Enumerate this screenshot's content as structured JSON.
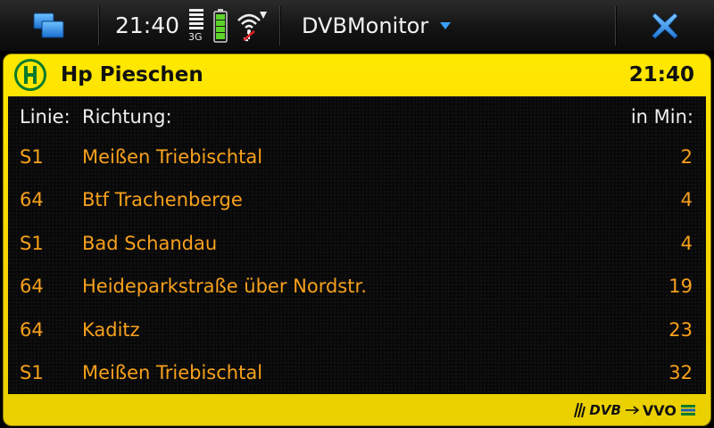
{
  "statusbar": {
    "clock": "21:40",
    "network": "3G",
    "app_title": "DVBMonitor",
    "icons": [
      "task-switcher-icon",
      "signal-icon",
      "battery-icon",
      "wifi-icon",
      "close-icon"
    ]
  },
  "panel": {
    "stop_name": "Hp Pieschen",
    "time": "21:40",
    "colors": {
      "panel": "#f6d400",
      "board": "#080808",
      "departure_text": "#f7a11c",
      "header_text": "#f0f0f0"
    },
    "columns": {
      "line": "Linie:",
      "direction": "Richtung:",
      "minutes": "in Min:"
    },
    "departures": [
      {
        "line": "S1",
        "direction": "Meißen Triebischtal",
        "minutes": "2"
      },
      {
        "line": "64",
        "direction": "Btf Trachenberge",
        "minutes": "4"
      },
      {
        "line": "S1",
        "direction": "Bad Schandau",
        "minutes": "4"
      },
      {
        "line": "64",
        "direction": "Heideparkstraße über Nordstr.",
        "minutes": "19"
      },
      {
        "line": "64",
        "direction": "Kaditz",
        "minutes": "23"
      },
      {
        "line": "S1",
        "direction": "Meißen Triebischtal",
        "minutes": "32"
      }
    ],
    "footer": {
      "logo_left": "DVB",
      "logo_right": "VVO"
    }
  }
}
